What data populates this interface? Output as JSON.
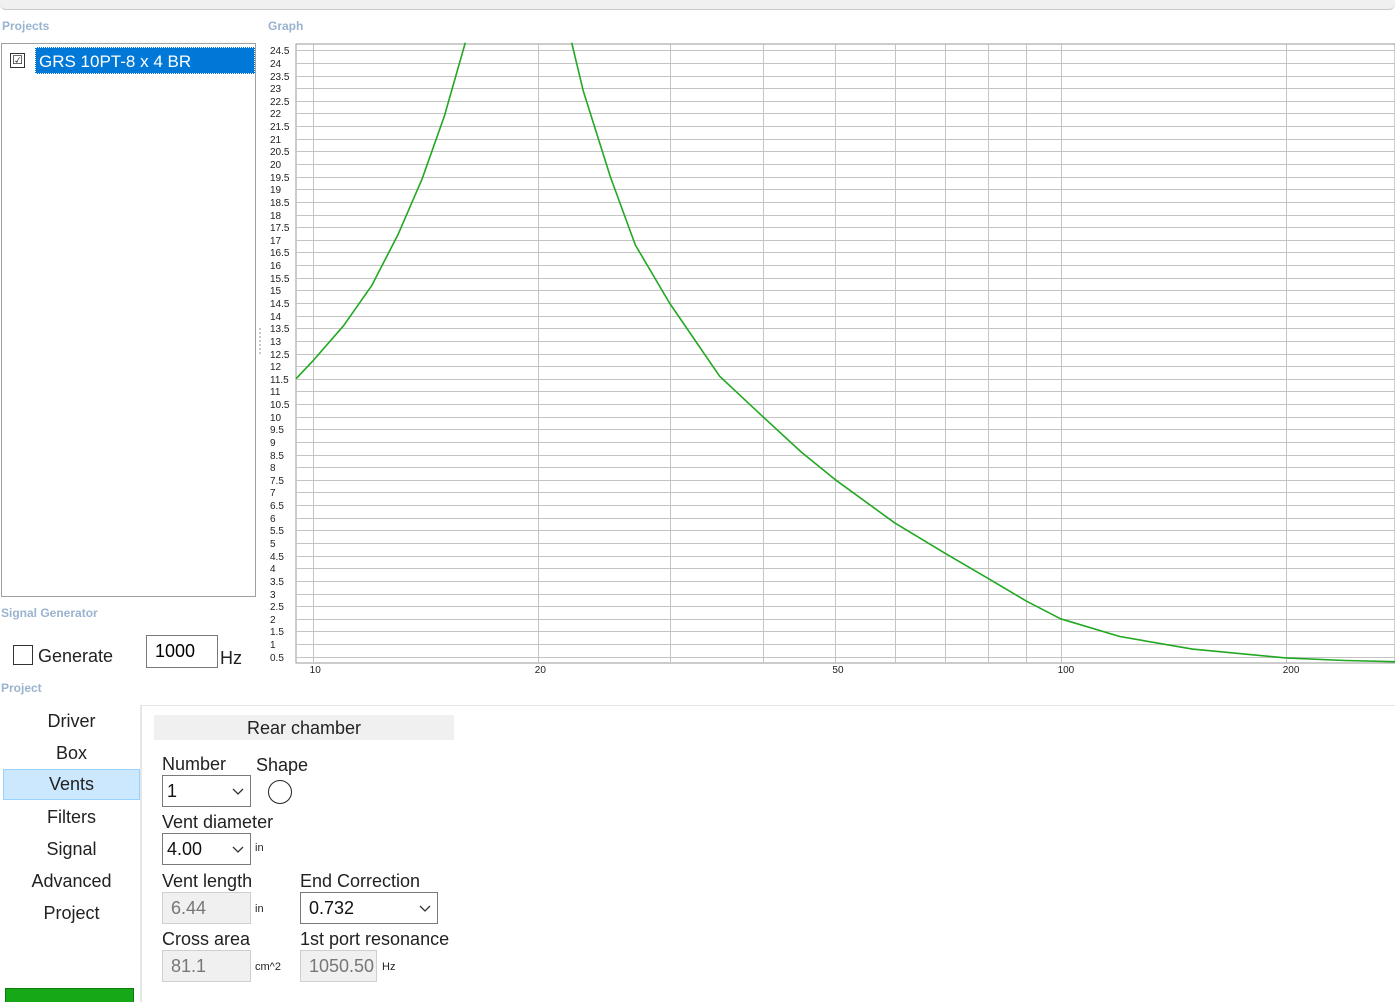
{
  "sections": {
    "projects": "Projects",
    "graph": "Graph",
    "signal_generator": "Signal Generator",
    "project": "Project"
  },
  "projects": {
    "items": [
      {
        "name": "GRS 10PT-8 x 4 BR",
        "checked": true,
        "checkmark": "☑"
      }
    ]
  },
  "signal_generator": {
    "generate_label": "Generate",
    "generate_checked": false,
    "frequency": "1000",
    "unit": "Hz"
  },
  "nav": {
    "items": [
      "Driver",
      "Box",
      "Vents",
      "Filters",
      "Signal",
      "Advanced",
      "Project"
    ],
    "active": "Vents"
  },
  "vents": {
    "tab_title": "Rear chamber",
    "number_label": "Number",
    "number_value": "1",
    "shape_label": "Shape",
    "shape_icon": "circle-icon",
    "diameter_label": "Vent diameter",
    "diameter_value": "4.00",
    "diameter_unit": "in",
    "length_label": "Vent length",
    "length_value": "6.44",
    "length_unit": "in",
    "end_correction_label": "End Correction",
    "end_correction_value": "0.732",
    "cross_area_label": "Cross area",
    "cross_area_value": "81.1",
    "cross_area_unit": "cm^2",
    "resonance_label": "1st port resonance",
    "resonance_value": "1050.50",
    "resonance_unit": "Hz"
  },
  "chart_data": {
    "type": "line",
    "title": "",
    "xlabel": "",
    "ylabel": "",
    "x_scale": "log",
    "xlim": [
      9.5,
      280
    ],
    "ylim": [
      0.25,
      24.75
    ],
    "grid": true,
    "x_tick_labels": [
      "10",
      "20",
      "50",
      "100",
      "200"
    ],
    "x_gridlines": [
      10,
      20,
      30,
      40,
      50,
      60,
      70,
      80,
      90,
      100,
      200
    ],
    "y_ticks": [
      0.5,
      1,
      1.5,
      2,
      2.5,
      3,
      3.5,
      4,
      4.5,
      5,
      5.5,
      6,
      6.5,
      7,
      7.5,
      8,
      8.5,
      9,
      9.5,
      10,
      10.5,
      11,
      11.5,
      12,
      12.5,
      13,
      13.5,
      14,
      14.5,
      15,
      15.5,
      16,
      16.5,
      17,
      17.5,
      18,
      18.5,
      19,
      19.5,
      20,
      20.5,
      21,
      21.5,
      22,
      22.5,
      23,
      23.5,
      24,
      24.5
    ],
    "line_color": "#22a822",
    "series": [
      {
        "segments": [
          [
            [
              9.5,
              11.5
            ],
            [
              10,
              12.2
            ],
            [
              11,
              13.6
            ],
            [
              12,
              15.2
            ],
            [
              13,
              17.2
            ],
            [
              14,
              19.4
            ],
            [
              15,
              21.9
            ],
            [
              16,
              24.8
            ]
          ],
          [
            [
              22.2,
              24.8
            ],
            [
              23,
              22.9
            ],
            [
              25,
              19.5
            ],
            [
              27,
              16.8
            ],
            [
              30,
              14.5
            ],
            [
              35,
              11.6
            ],
            [
              40,
              10.0
            ],
            [
              45,
              8.6
            ],
            [
              50,
              7.5
            ],
            [
              60,
              5.8
            ],
            [
              70,
              4.6
            ],
            [
              80,
              3.6
            ],
            [
              90,
              2.7
            ],
            [
              100,
              2.0
            ],
            [
              120,
              1.3
            ],
            [
              150,
              0.8
            ],
            [
              200,
              0.45
            ],
            [
              240,
              0.35
            ],
            [
              280,
              0.3
            ]
          ]
        ]
      }
    ]
  }
}
